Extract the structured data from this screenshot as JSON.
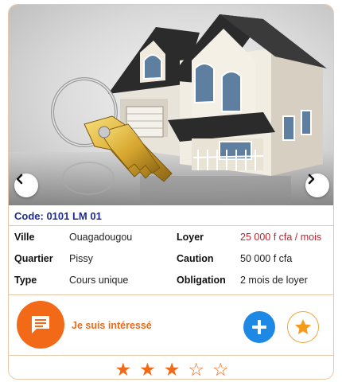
{
  "listing": {
    "code": "Code: 0101 LM 01",
    "fields": {
      "ville_label": "Ville",
      "ville_value": "Ouagadougou",
      "quartier_label": "Quartier",
      "quartier_value": "Pissy",
      "type_label": "Type",
      "type_value": "Cours unique",
      "loyer_label": "Loyer",
      "loyer_value": "25 000 f cfa / mois",
      "caution_label": "Caution",
      "caution_value": "50 000 f cfa",
      "obligation_label": "Obligation",
      "obligation_value": "2 mois de loyer"
    }
  },
  "actions": {
    "interest_label": "Je suis intéressé"
  },
  "rating": {
    "value": 3,
    "max": 5,
    "filled_glyph": "★",
    "empty_glyph": "☆"
  },
  "icons": {
    "prev": "chevron-left-icon",
    "next": "chevron-right-icon",
    "chat": "chat-icon",
    "plus": "plus-icon",
    "favorite": "star-icon"
  },
  "colors": {
    "accent_orange": "#f26a18",
    "code_blue": "#1f2d8f",
    "price_red": "#c8202a",
    "plus_blue": "#1e88e5",
    "border": "#e7c9a9"
  }
}
